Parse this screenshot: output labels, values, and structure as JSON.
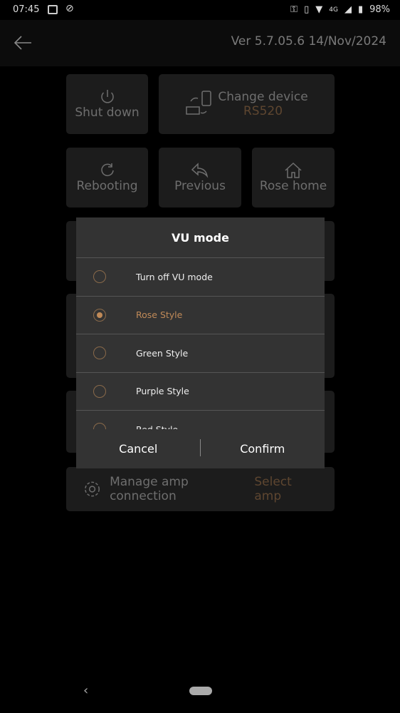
{
  "status_bar": {
    "time": "07:45",
    "battery": "98%",
    "network": "4G"
  },
  "header": {
    "version": "Ver 5.7.05.6  14/Nov/2024"
  },
  "tiles": {
    "shutdown": "Shut down",
    "change_device": "Change device",
    "device_name": "RS520",
    "rebooting": "Rebooting",
    "previous": "Previous",
    "rose_home": "Rose home"
  },
  "amp": {
    "label": "Manage amp connection",
    "action": "Select amp"
  },
  "dialog": {
    "title": "VU mode",
    "options": [
      {
        "label": "Turn off VU mode",
        "selected": false
      },
      {
        "label": "Rose Style",
        "selected": true
      },
      {
        "label": "Green Style",
        "selected": false
      },
      {
        "label": "Purple Style",
        "selected": false
      },
      {
        "label": "Red Style",
        "selected": false
      }
    ],
    "cancel": "Cancel",
    "confirm": "Confirm"
  },
  "colors": {
    "accent": "#c08a58",
    "dialog_bg": "#333333",
    "card_bg": "#1c1c1c"
  }
}
